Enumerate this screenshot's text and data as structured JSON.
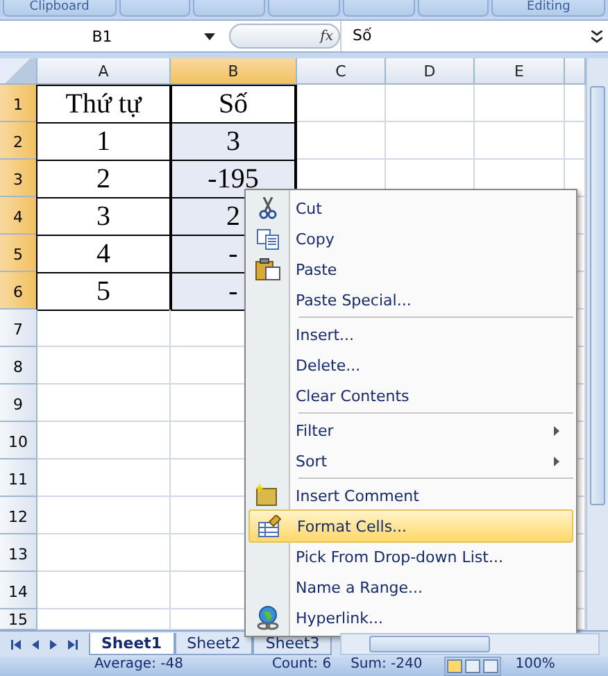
{
  "ribbon": {
    "groups": [
      {
        "label": "Clipboard"
      },
      {
        "label": "Editing"
      }
    ]
  },
  "formula_bar": {
    "name_box": "B1",
    "function_button": "fx",
    "formula": "Số"
  },
  "columns": [
    {
      "label": "A",
      "selected": false
    },
    {
      "label": "B",
      "selected": true
    },
    {
      "label": "C",
      "selected": false
    },
    {
      "label": "D",
      "selected": false
    },
    {
      "label": "E",
      "selected": false
    }
  ],
  "rows": [
    {
      "label": "1",
      "selected": true,
      "cells": [
        "Thứ tự",
        "Số"
      ]
    },
    {
      "label": "2",
      "selected": true,
      "cells": [
        "1",
        "3"
      ]
    },
    {
      "label": "3",
      "selected": true,
      "cells": [
        "2",
        "-195"
      ]
    },
    {
      "label": "4",
      "selected": true,
      "cells": [
        "3",
        "2"
      ]
    },
    {
      "label": "5",
      "selected": true,
      "cells": [
        "4",
        "-"
      ]
    },
    {
      "label": "6",
      "selected": true,
      "cells": [
        "5",
        "-"
      ]
    },
    {
      "label": "7",
      "selected": false
    },
    {
      "label": "8",
      "selected": false
    },
    {
      "label": "9",
      "selected": false
    },
    {
      "label": "10",
      "selected": false
    },
    {
      "label": "11",
      "selected": false
    },
    {
      "label": "12",
      "selected": false
    },
    {
      "label": "13",
      "selected": false
    },
    {
      "label": "14",
      "selected": false
    },
    {
      "label": "15",
      "selected": false
    }
  ],
  "context_menu": {
    "items": [
      {
        "kind": "item",
        "label": "Cut",
        "selected": false
      },
      {
        "kind": "item",
        "label": "Copy",
        "selected": false
      },
      {
        "kind": "item",
        "label": "Paste",
        "selected": false
      },
      {
        "kind": "item",
        "label": "Paste Special...",
        "selected": false
      },
      {
        "kind": "separator"
      },
      {
        "kind": "item",
        "label": "Insert...",
        "selected": false
      },
      {
        "kind": "item",
        "label": "Delete...",
        "selected": false
      },
      {
        "kind": "item",
        "label": "Clear Contents",
        "selected": false
      },
      {
        "kind": "separator"
      },
      {
        "kind": "item",
        "label": "Filter",
        "selected": false,
        "submenu": true
      },
      {
        "kind": "item",
        "label": "Sort",
        "selected": false,
        "submenu": true
      },
      {
        "kind": "separator"
      },
      {
        "kind": "item",
        "label": "Insert Comment",
        "selected": false
      },
      {
        "kind": "item",
        "label": "Format Cells...",
        "selected": true
      },
      {
        "kind": "item",
        "label": "Pick From Drop-down List...",
        "selected": false
      },
      {
        "kind": "item",
        "label": "Name a Range...",
        "selected": false
      },
      {
        "kind": "item",
        "label": "Hyperlink...",
        "selected": false
      }
    ]
  },
  "sheet_tabs": [
    {
      "label": "Sheet1",
      "selected": true
    },
    {
      "label": "Sheet2",
      "selected": false
    },
    {
      "label": "Sheet3",
      "selected": false
    }
  ],
  "status_bar": {
    "average": "Average: -48",
    "count": "Count: 6",
    "sum": "Sum: -240",
    "zoom": "100%"
  }
}
